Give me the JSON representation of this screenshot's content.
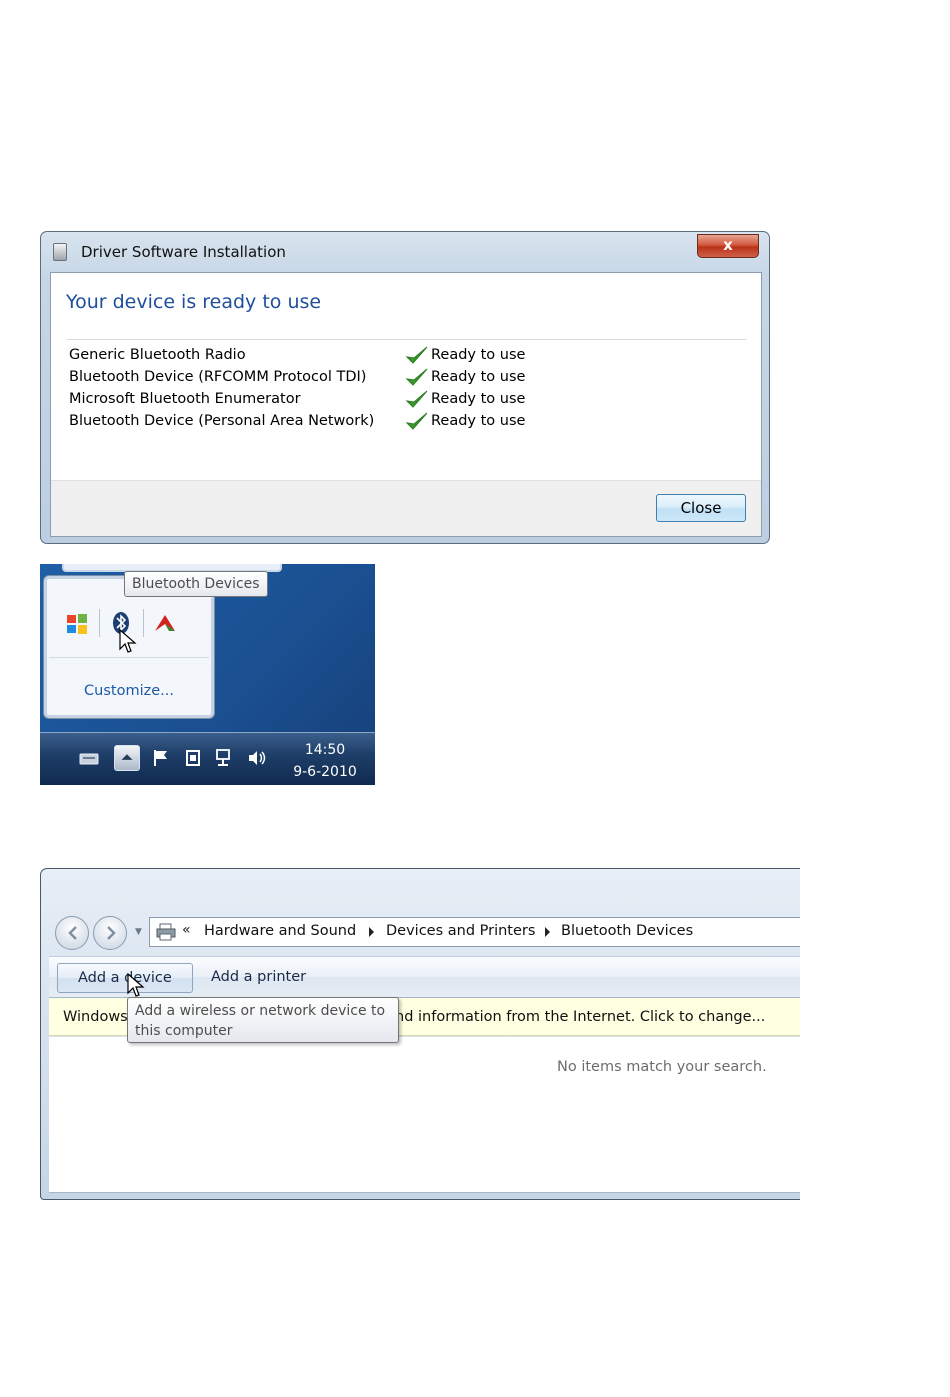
{
  "driver_dialog": {
    "title": "Driver Software Installation",
    "close_glyph": "x",
    "heading": "Your device is ready to use",
    "devices": [
      {
        "name": "Generic Bluetooth Radio",
        "status": "Ready to use"
      },
      {
        "name": "Bluetooth Device (RFCOMM Protocol TDI)",
        "status": "Ready to use"
      },
      {
        "name": "Microsoft Bluetooth Enumerator",
        "status": "Ready to use"
      },
      {
        "name": "Bluetooth Device (Personal Area Network)",
        "status": "Ready to use"
      }
    ],
    "close_button": "Close"
  },
  "tray": {
    "tooltip": "Bluetooth Devices",
    "icons": [
      "windows-flag-icon",
      "bluetooth-icon",
      "red-arrow-icon"
    ],
    "customize": "Customize...",
    "clock_time": "14:50",
    "clock_date": "9-6-2010"
  },
  "explorer": {
    "breadcrumb_chevron": "«",
    "breadcrumbs": [
      "Hardware and Sound",
      "Devices and Printers",
      "Bluetooth Devices"
    ],
    "toolbar": {
      "add_device": "Add a device",
      "add_printer": "Add a printer"
    },
    "infobar": {
      "left": "Windows",
      "right": "nd information from the Internet. Click to change..."
    },
    "tooltip_line1": "Add a wireless or network device to",
    "tooltip_line2": "this computer",
    "empty_message": "No items match your search."
  },
  "colors": {
    "heading_blue": "#1e4f9e",
    "check_green": "#3a9a2c",
    "taskbar_blue": "#1a4f90",
    "info_yellow": "#ffffe1"
  }
}
